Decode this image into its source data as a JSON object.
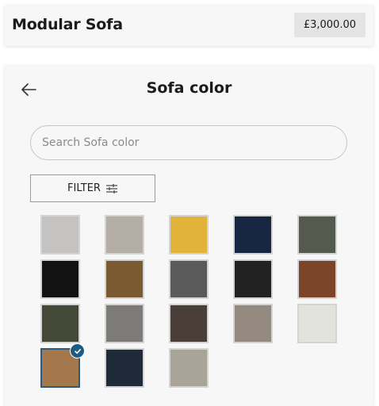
{
  "header": {
    "title": "Modular Sofa",
    "price": "£3,000.00"
  },
  "panel": {
    "title": "Sofa color",
    "back_icon": "arrow-left-icon",
    "search": {
      "placeholder": "Search Sofa color",
      "value": ""
    },
    "filter": {
      "label": "FILTER",
      "icon": "sliders-icon"
    }
  },
  "swatches": [
    {
      "name": "light-grey",
      "color": "#c4c3c1",
      "selected": false
    },
    {
      "name": "oatmeal-tweed",
      "color": "#b5aea6",
      "selected": false
    },
    {
      "name": "mustard",
      "color": "#e2b33a",
      "selected": false
    },
    {
      "name": "navy",
      "color": "#172741",
      "selected": false
    },
    {
      "name": "olive-grey",
      "color": "#545a4d",
      "selected": false
    },
    {
      "name": "black",
      "color": "#121212",
      "selected": false
    },
    {
      "name": "tan-brown",
      "color": "#7a5a30",
      "selected": false
    },
    {
      "name": "graphite",
      "color": "#5a5a5a",
      "selected": false
    },
    {
      "name": "charcoal",
      "color": "#222222",
      "selected": false
    },
    {
      "name": "rust",
      "color": "#7c4529",
      "selected": false
    },
    {
      "name": "moss",
      "color": "#434936",
      "selected": false
    },
    {
      "name": "warm-grey",
      "color": "#7d7b78",
      "selected": false
    },
    {
      "name": "dark-chocolate",
      "color": "#4a3f38",
      "selected": false
    },
    {
      "name": "taupe",
      "color": "#948a80",
      "selected": false
    },
    {
      "name": "ivory",
      "color": "#e3e3dd",
      "selected": false
    },
    {
      "name": "camel",
      "color": "#a4784a",
      "selected": true
    },
    {
      "name": "dark-slate",
      "color": "#1e2a37",
      "selected": false
    },
    {
      "name": "stone-tweed",
      "color": "#aaa498",
      "selected": false
    }
  ]
}
